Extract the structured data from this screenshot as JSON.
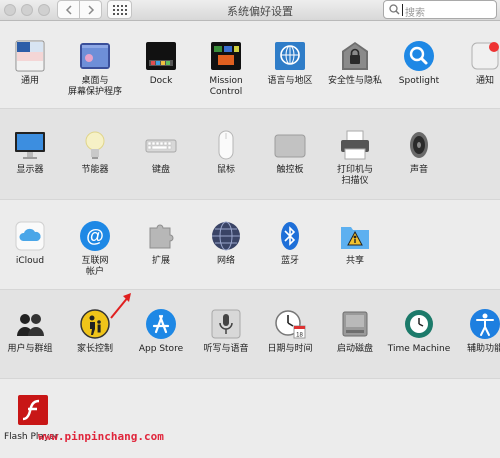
{
  "window": {
    "title": "系统偏好设置"
  },
  "search": {
    "placeholder": "搜索"
  },
  "sections": {
    "personal": [
      {
        "label": "通用",
        "icon": "general-icon"
      },
      {
        "label": "桌面与\n屏幕保护程序",
        "icon": "desktop-screensaver-icon"
      },
      {
        "label": "Dock",
        "icon": "dock-icon"
      },
      {
        "label": "Mission\nControl",
        "icon": "mission-control-icon"
      },
      {
        "label": "语言与地区",
        "icon": "language-region-icon"
      },
      {
        "label": "安全性与隐私",
        "icon": "security-privacy-icon"
      },
      {
        "label": "Spotlight",
        "icon": "spotlight-icon"
      },
      {
        "label": "通知",
        "icon": "notifications-icon"
      }
    ],
    "hardware": [
      {
        "label": "显示器",
        "icon": "displays-icon"
      },
      {
        "label": "节能器",
        "icon": "energy-saver-icon"
      },
      {
        "label": "键盘",
        "icon": "keyboard-icon"
      },
      {
        "label": "鼠标",
        "icon": "mouse-icon"
      },
      {
        "label": "触控板",
        "icon": "trackpad-icon"
      },
      {
        "label": "打印机与\n扫描仪",
        "icon": "printers-scanners-icon"
      },
      {
        "label": "声音",
        "icon": "sound-icon"
      }
    ],
    "internet": [
      {
        "label": "iCloud",
        "icon": "icloud-icon"
      },
      {
        "label": "互联网\n帐户",
        "icon": "internet-accounts-icon"
      },
      {
        "label": "扩展",
        "icon": "extensions-icon"
      },
      {
        "label": "网络",
        "icon": "network-icon"
      },
      {
        "label": "蓝牙",
        "icon": "bluetooth-icon"
      },
      {
        "label": "共享",
        "icon": "sharing-icon"
      }
    ],
    "system": [
      {
        "label": "用户与群组",
        "icon": "users-groups-icon"
      },
      {
        "label": "家长控制",
        "icon": "parental-controls-icon"
      },
      {
        "label": "App Store",
        "icon": "app-store-icon"
      },
      {
        "label": "听写与语音",
        "icon": "dictation-speech-icon"
      },
      {
        "label": "日期与时间",
        "icon": "date-time-icon"
      },
      {
        "label": "启动磁盘",
        "icon": "startup-disk-icon"
      },
      {
        "label": "Time Machine",
        "icon": "time-machine-icon"
      },
      {
        "label": "辅助功能",
        "icon": "accessibility-icon"
      }
    ],
    "other": [
      {
        "label": "Flash Player",
        "icon": "flash-player-icon"
      }
    ]
  },
  "watermark": "www.pinpinchang.com",
  "colors": {
    "accent": "#1e88e5",
    "arrow": "#e02020"
  }
}
